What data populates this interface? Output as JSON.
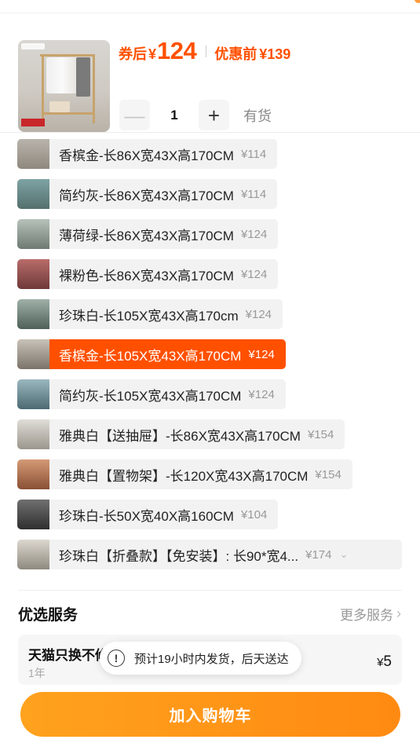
{
  "header": {
    "price_after_label": "券后",
    "price_currency": "¥",
    "price_after_value": "124",
    "price_before_label": "优惠前",
    "price_before_currency": "¥",
    "price_before_value": "139",
    "quantity": "1",
    "minus_symbol": "—",
    "plus_symbol": "+",
    "stock_status": "有货"
  },
  "sku_options": [
    {
      "name": "香槟金-长86X宽43X高170CM",
      "price": "¥114",
      "selected": false
    },
    {
      "name": "简约灰-长86X宽43X高170CM",
      "price": "¥114",
      "selected": false
    },
    {
      "name": "薄荷绿-长86X宽43X高170CM",
      "price": "¥124",
      "selected": false
    },
    {
      "name": "裸粉色-长86X宽43X高170CM",
      "price": "¥124",
      "selected": false
    },
    {
      "name": "珍珠白-长105X宽43X高170cm",
      "price": "¥124",
      "selected": false
    },
    {
      "name": "香槟金-长105X宽43X高170CM",
      "price": "¥124",
      "selected": true
    },
    {
      "name": "简约灰-长105X宽43X高170CM",
      "price": "¥124",
      "selected": false
    },
    {
      "name": "雅典白【送抽屉】-长86X宽43X高170CM",
      "price": "¥154",
      "selected": false
    },
    {
      "name": "雅典白【置物架】-长120X宽43X高170CM",
      "price": "¥154",
      "selected": false
    },
    {
      "name": "珍珠白-长50X宽40X高160CM",
      "price": "¥104",
      "selected": false
    },
    {
      "name": "珍珠白【折叠款】【免安装】: 长90*宽4...",
      "price": "¥174",
      "selected": false
    }
  ],
  "service": {
    "title": "优选服务",
    "more_label": "更多服务",
    "item_name": "天猫只换不修",
    "item_term": "1年",
    "item_currency": "¥",
    "item_price": "5"
  },
  "toast": {
    "icon": "!",
    "text": "预计19小时内发货，后天送达"
  },
  "cart_button_label": "加入购物车",
  "colors": {
    "accent": "#ff5000",
    "button_gradient_start": "#ffa21e",
    "button_gradient_end": "#ff8a12"
  }
}
